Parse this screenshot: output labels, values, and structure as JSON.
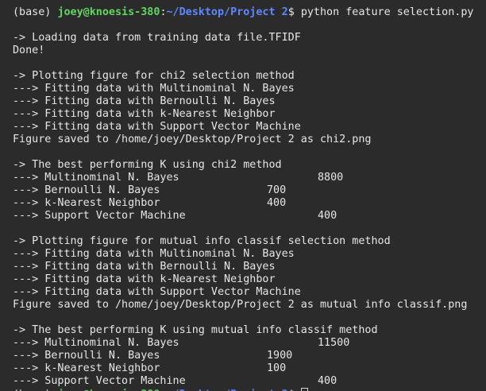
{
  "terminal": {
    "prompt": {
      "env": "(base) ",
      "user_host": "joey@knoesis-380",
      "sep": ":",
      "path": "~/Desktop/Project 2",
      "dollar": "$ ",
      "command": "python feature selection.py"
    },
    "load_lines": [
      "-> Loading data from training data file.TFIDF",
      "Done!"
    ],
    "chi2_section": {
      "header": "-> Plotting figure for chi2 selection method",
      "fits": [
        "---> Fitting data with Multinominal N. Bayes",
        "---> Fitting data with Bernoulli N. Bayes",
        "---> Fitting data with k-Nearest Neighbor",
        "---> Fitting data with Support Vector Machine"
      ],
      "saved": "Figure saved to /home/joey/Desktop/Project 2 as chi2.png",
      "best_header": "-> The best performing K using chi2 method",
      "results": [
        {
          "label": "---> Multinominal N. Bayes",
          "value": "8800"
        },
        {
          "label": "---> Bernoulli N. Bayes",
          "value": "700"
        },
        {
          "label": "---> k-Nearest Neighbor",
          "value": "400"
        },
        {
          "label": "---> Support Vector Machine",
          "value": "400"
        }
      ]
    },
    "mi_section": {
      "header": "-> Plotting figure for mutual info classif selection method",
      "fits": [
        "---> Fitting data with Multinominal N. Bayes",
        "---> Fitting data with Bernoulli N. Bayes",
        "---> Fitting data with k-Nearest Neighbor",
        "---> Fitting data with Support Vector Machine"
      ],
      "saved": "Figure saved to /home/joey/Desktop/Project 2 as mutual info classif.png",
      "best_header": "-> The best performing K using mutual info classif method",
      "results": [
        {
          "label": "---> Multinominal N. Bayes",
          "value": "11500"
        },
        {
          "label": "---> Bernoulli N. Bayes",
          "value": "1900"
        },
        {
          "label": "---> k-Nearest Neighbor",
          "value": "100"
        },
        {
          "label": "---> Support Vector Machine",
          "value": "400"
        }
      ]
    }
  }
}
